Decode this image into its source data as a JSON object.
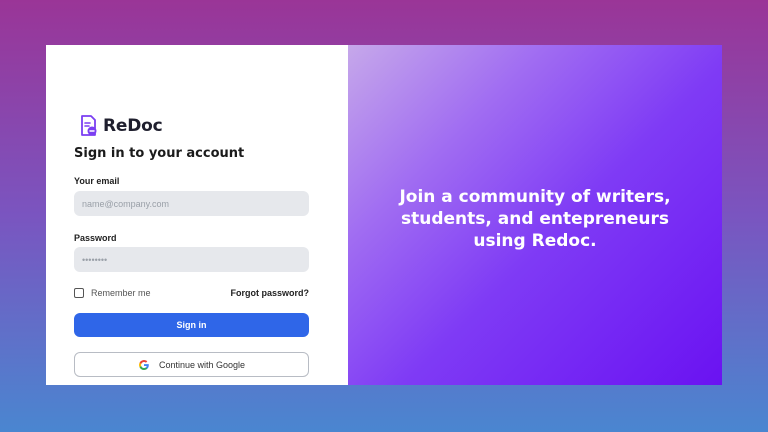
{
  "brand": {
    "name": "ReDoc",
    "logo_icon": "document-icon"
  },
  "form": {
    "heading": "Sign in to your account",
    "email": {
      "label": "Your email",
      "placeholder": "name@company.com",
      "value": ""
    },
    "password": {
      "label": "Password",
      "placeholder": "••••••••",
      "value": ""
    },
    "remember_me": {
      "label": "Remember me",
      "checked": false
    },
    "forgot_password": "Forgot password?",
    "sign_in": "Sign in",
    "google": {
      "label": "Continue with Google",
      "icon": "google-icon"
    }
  },
  "promo": {
    "tagline": "Join a community of writers, students, and entepreneurs using Redoc."
  },
  "colors": {
    "primary_button": "#2f66e8",
    "brand_purple": "#7b3ff2",
    "panel_gradient_end": "#6a12f2"
  }
}
